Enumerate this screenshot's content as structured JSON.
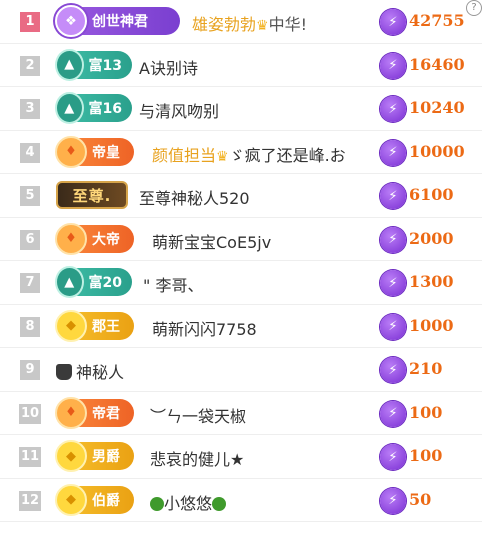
{
  "help_label": "?",
  "rows": [
    {
      "rank": "1",
      "badge": "创世神君",
      "name": "雄姿勃勃",
      "name2": "中华!",
      "score": "42755"
    },
    {
      "rank": "2",
      "badge": "富13",
      "name": "A诀别诗",
      "score": "16460"
    },
    {
      "rank": "3",
      "badge": "富16",
      "name": "与清风吻别",
      "score": "10240"
    },
    {
      "rank": "4",
      "badge": "帝皇",
      "name": "颜值担当",
      "name2": "ゞ疯了还是峰.お",
      "score": "10000"
    },
    {
      "rank": "5",
      "badge": "至尊.",
      "name": "至尊神秘人520",
      "score": "6100"
    },
    {
      "rank": "6",
      "badge": "大帝",
      "name": "萌新宝宝CoE5jv",
      "score": "2000"
    },
    {
      "rank": "7",
      "badge": "富20",
      "name": "\" 李哥、",
      "score": "1300"
    },
    {
      "rank": "8",
      "badge": "郡王",
      "name": "萌新闪闪7758",
      "score": "1000"
    },
    {
      "rank": "9",
      "badge": "",
      "name": "神秘人",
      "score": "210"
    },
    {
      "rank": "10",
      "badge": "帝君",
      "name": "︶ㄣ一袋天椒",
      "score": "100"
    },
    {
      "rank": "11",
      "badge": "男爵",
      "name": "悲哀的健儿★",
      "score": "100"
    },
    {
      "rank": "12",
      "badge": "伯爵",
      "name": "小悠悠",
      "score": "50"
    }
  ]
}
